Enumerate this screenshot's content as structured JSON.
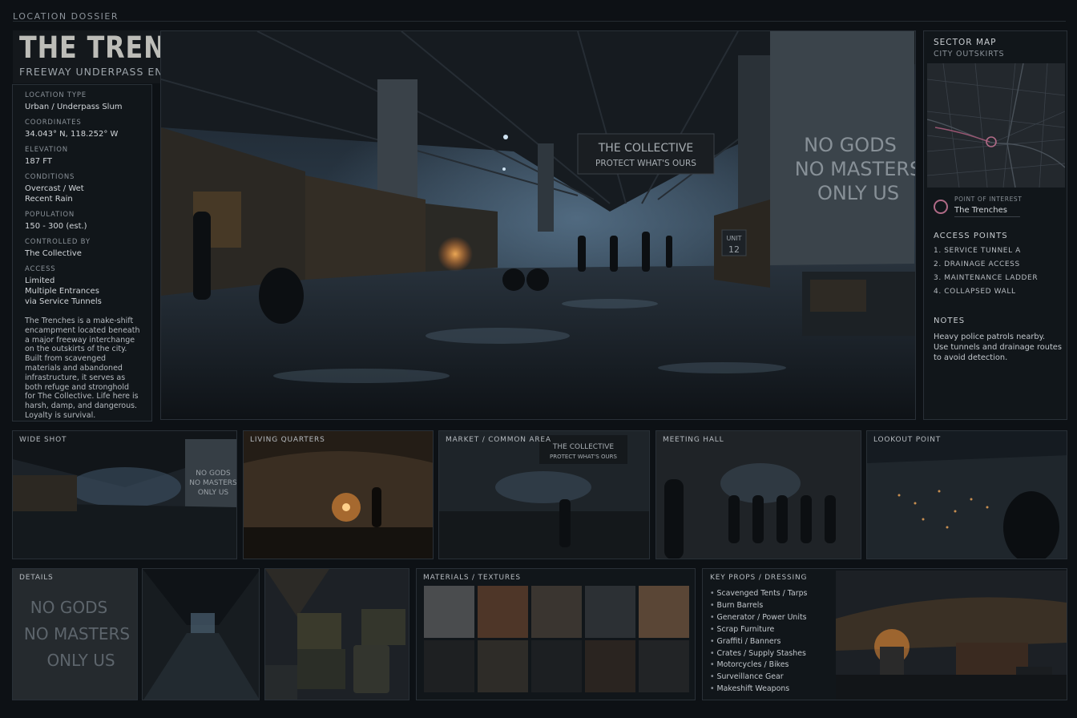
{
  "header": {
    "label": "LOCATION DOSSIER",
    "title": "THE TRENCHES",
    "subtitle": "FREEWAY UNDERPASS ENCAMPMENT"
  },
  "info": {
    "fields": [
      {
        "label": "LOCATION TYPE",
        "value": "Urban / Underpass Slum"
      },
      {
        "label": "COORDINATES",
        "value": "34.043° N, 118.252° W"
      },
      {
        "label": "ELEVATION",
        "value": "187 FT"
      },
      {
        "label": "CONDITIONS",
        "value": "Overcast / Wet\nRecent Rain"
      },
      {
        "label": "POPULATION",
        "value": "150 - 300 (est.)"
      },
      {
        "label": "CONTROLLED BY",
        "value": "The Collective"
      },
      {
        "label": "ACCESS",
        "value": "Limited\nMultiple Entrances\nvia Service Tunnels"
      }
    ],
    "description": "The Trenches is a make-shift encampment located beneath a major freeway interchange on the outskirts of the city. Built from scavenged materials and abandoned infrastructure, it serves as both refuge and stronghold for The Collective. Life here is harsh, damp, and dangerous. Loyalty is survival."
  },
  "hero": {
    "banner_line1": "THE COLLECTIVE",
    "banner_line2": "PROTECT WHAT'S OURS",
    "graffiti": [
      "NO GODS",
      "NO MASTERS",
      "ONLY US"
    ],
    "unit_label": "UNIT",
    "unit_number": "12"
  },
  "sidebar": {
    "title": "SECTOR MAP",
    "subtitle": "CITY OUTSKIRTS",
    "poi_label": "POINT OF INTEREST",
    "poi_name": "The Trenches",
    "access_title": "ACCESS POINTS",
    "access_points": [
      "1. SERVICE TUNNEL A",
      "2. DRAINAGE ACCESS",
      "3. MAINTENANCE LADDER",
      "4. COLLAPSED WALL"
    ],
    "notes_title": "NOTES",
    "notes_body": "Heavy police patrols nearby. Use tunnels and drainage routes to avoid detection.",
    "accent_color": "#b06a86"
  },
  "thumbnails": {
    "wide_shot": "WIDE SHOT",
    "living_quarters": "LIVING QUARTERS",
    "market": "MARKET / COMMON AREA",
    "meeting_hall": "MEETING HALL",
    "lookout": "LOOKOUT POINT",
    "details": "DETAILS"
  },
  "materials": {
    "title": "MATERIALS / TEXTURES",
    "swatch_colors": [
      "#4a4c4e",
      "#4e3628",
      "#3a3530",
      "#2c3034",
      "#5a4636",
      "#1e2022",
      "#2e2c28",
      "#1c1f22",
      "#2a2420",
      "#222426"
    ]
  },
  "props": {
    "title": "KEY PROPS / DRESSING",
    "items": [
      "Scavenged Tents / Tarps",
      "Burn Barrels",
      "Generator / Power Units",
      "Scrap Furniture",
      "Graffiti / Banners",
      "Crates / Supply Stashes",
      "Motorcycles / Bikes",
      "Surveillance Gear",
      "Makeshift Weapons"
    ]
  }
}
